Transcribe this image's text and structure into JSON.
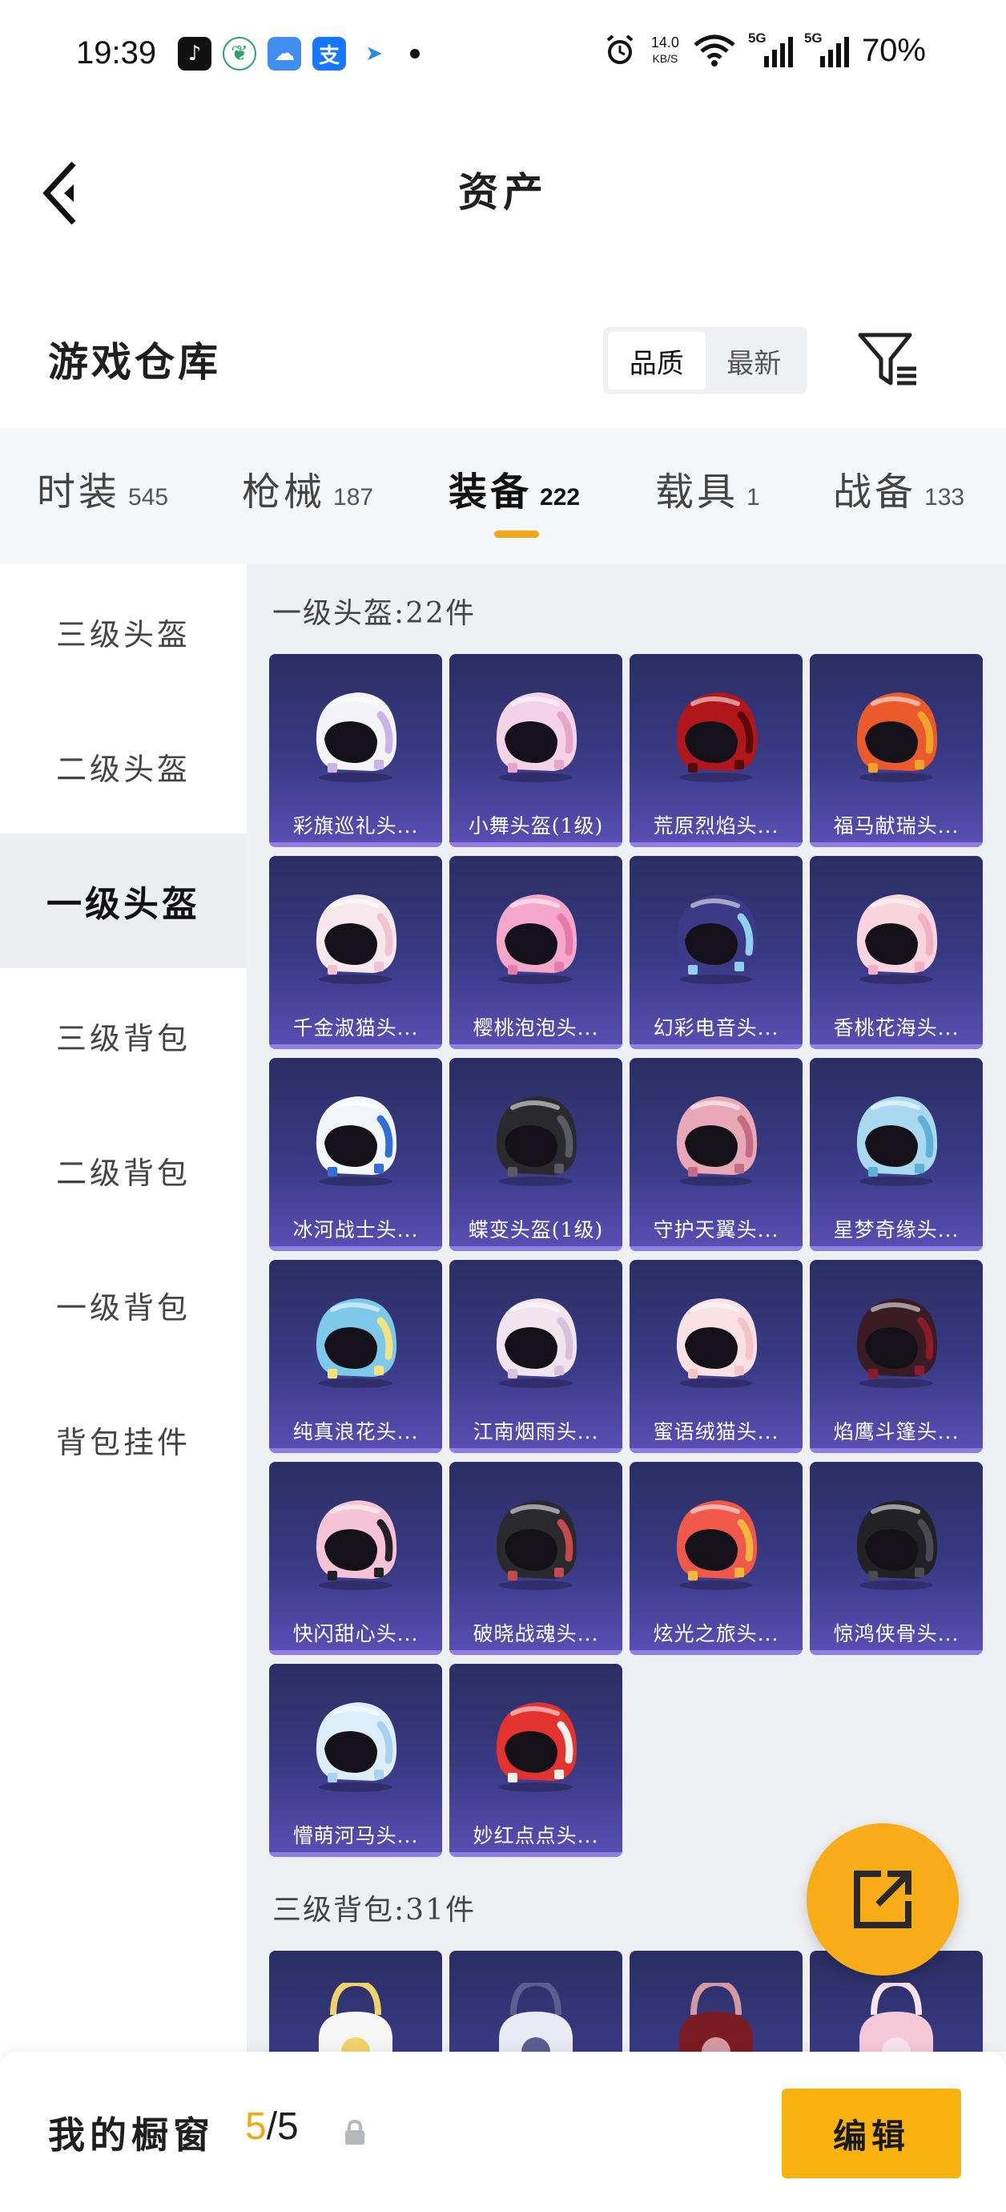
{
  "status_bar": {
    "time": "19:39",
    "net_speed_value": "14.0",
    "net_speed_unit": "KB/S",
    "signal_1": "5G",
    "signal_2": "5G",
    "battery": "70%",
    "apps": [
      "tiktok-icon",
      "leaf-app-icon",
      "weather-icon",
      "alipay-icon",
      "flight-icon"
    ]
  },
  "header": {
    "title": "资产"
  },
  "warehouse": {
    "title": "游戏仓库",
    "sort_options": [
      "品质",
      "最新"
    ],
    "sort_active": "品质"
  },
  "categories": [
    {
      "name": "时装",
      "count": "545"
    },
    {
      "name": "枪械",
      "count": "187"
    },
    {
      "name": "装备",
      "count": "222",
      "active": true
    },
    {
      "name": "载具",
      "count": "1"
    },
    {
      "name": "战备",
      "count": "133"
    }
  ],
  "sidebar": {
    "items": [
      "三级头盔",
      "二级头盔",
      "一级头盔",
      "三级背包",
      "二级背包",
      "一级背包",
      "背包挂件"
    ],
    "active": "一级头盔"
  },
  "sections": [
    {
      "title": "一级头盔:22件",
      "items": [
        {
          "label": "彩旗巡礼头...",
          "colors": [
            "#f4f4f8",
            "#c9b4e8"
          ]
        },
        {
          "label": "小舞头盔(1级)",
          "colors": [
            "#f5d3e6",
            "#e6a6cb"
          ]
        },
        {
          "label": "荒原烈焰头...",
          "colors": [
            "#b1161a",
            "#5a0a0a"
          ]
        },
        {
          "label": "福马献瑞头...",
          "colors": [
            "#ea5a2a",
            "#f2a32c"
          ]
        },
        {
          "label": "千金淑猫头...",
          "colors": [
            "#f7e8ee",
            "#f2c2d2"
          ]
        },
        {
          "label": "樱桃泡泡头...",
          "colors": [
            "#f4a7c8",
            "#e77aa7"
          ]
        },
        {
          "label": "幻彩电音头...",
          "colors": [
            "#3b3a86",
            "#8fd0f1"
          ]
        },
        {
          "label": "香桃花海头...",
          "colors": [
            "#f8d4de",
            "#f3b0c4"
          ]
        },
        {
          "label": "冰河战士头...",
          "colors": [
            "#f2f6fb",
            "#2f6fd6"
          ]
        },
        {
          "label": "蝶变头盔(1级)",
          "colors": [
            "#2a2a2e",
            "#5a5a64"
          ]
        },
        {
          "label": "守护天翼头...",
          "colors": [
            "#e8a8b8",
            "#c56b83"
          ]
        },
        {
          "label": "星梦奇缘头...",
          "colors": [
            "#a9d9ef",
            "#5fb0d8"
          ]
        },
        {
          "label": "纯真浪花头...",
          "colors": [
            "#7dc9ea",
            "#f4e27a"
          ]
        },
        {
          "label": "江南烟雨头...",
          "colors": [
            "#f1e4ee",
            "#d6c2dc"
          ]
        },
        {
          "label": "蜜语绒猫头...",
          "colors": [
            "#f9e0e2",
            "#f3c4c8"
          ]
        },
        {
          "label": "焰鹰斗篷头...",
          "colors": [
            "#3a1c24",
            "#8a1c2a"
          ]
        },
        {
          "label": "快闪甜心头...",
          "colors": [
            "#f5c2d6",
            "#222226"
          ]
        },
        {
          "label": "破晓战魂头...",
          "colors": [
            "#2a2a2e",
            "#c24a4a"
          ]
        },
        {
          "label": "炫光之旅头...",
          "colors": [
            "#f0584a",
            "#f3b53a"
          ]
        },
        {
          "label": "惊鸿侠骨头...",
          "colors": [
            "#222226",
            "#4a4a52"
          ]
        },
        {
          "label": "懵萌河马头...",
          "colors": [
            "#dbeefa",
            "#a8d3ef"
          ]
        },
        {
          "label": "妙红点点头...",
          "colors": [
            "#e4332e",
            "#f6f0ea"
          ]
        }
      ]
    },
    {
      "title": "三级背包:31件",
      "items": [
        {
          "label": "",
          "colors": [
            "#f6f6f6",
            "#f0d36a"
          ]
        },
        {
          "label": "",
          "colors": [
            "#e9eaf2",
            "#5a5f8f"
          ]
        },
        {
          "label": "",
          "colors": [
            "#7a1c22",
            "#d49aa4"
          ]
        },
        {
          "label": "",
          "colors": [
            "#f4c8d6",
            "#f7e4ec"
          ]
        }
      ]
    }
  ],
  "bottom_bar": {
    "showcase_label": "我的橱窗",
    "showcase_used": "5",
    "showcase_sep": "/",
    "showcase_total": "5",
    "edit_label": "编辑"
  },
  "accent_color": "#f2a816"
}
